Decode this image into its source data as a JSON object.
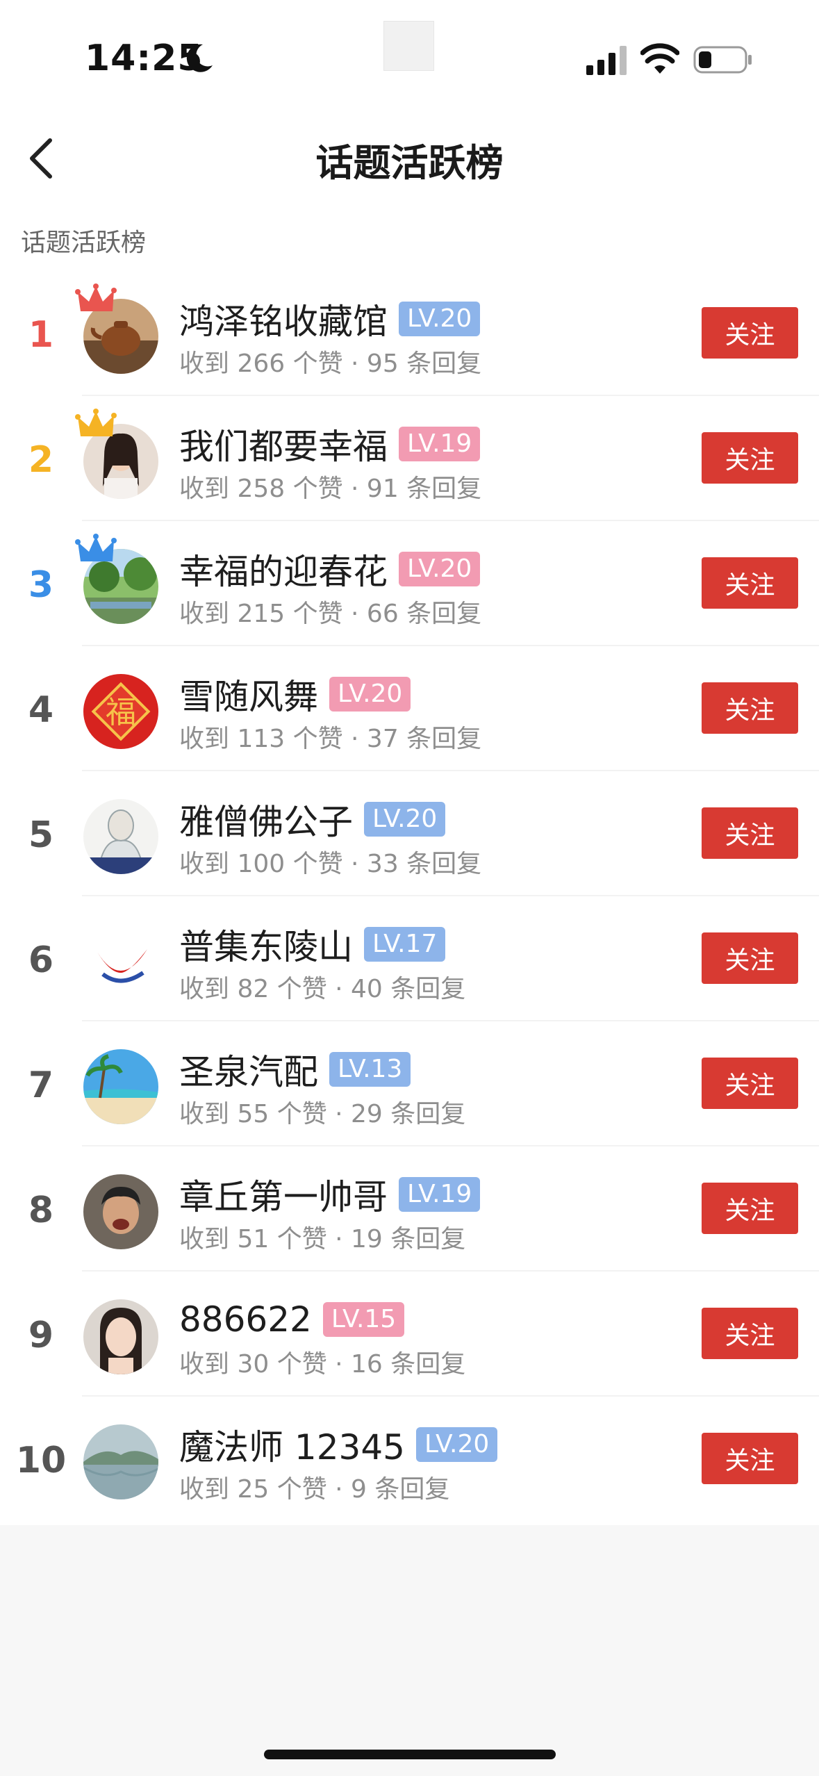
{
  "status_bar": {
    "time": "14:25"
  },
  "nav": {
    "title": "话题活跃榜"
  },
  "section_label": "话题活跃榜",
  "follow_label": "关注",
  "rank_colors": {
    "1": "#e9554f",
    "2": "#f5b324",
    "3": "#3a8ee6"
  },
  "items": [
    {
      "rank": "1",
      "name": "鸿泽铭收藏馆",
      "level": "LV.20",
      "level_color": "blue",
      "stats": "收到 266 个赞 · 95 条回复",
      "avatar": "teapot"
    },
    {
      "rank": "2",
      "name": "我们都要幸福",
      "level": "LV.19",
      "level_color": "pink",
      "stats": "收到 258 个赞 · 91 条回复",
      "avatar": "woman-portrait"
    },
    {
      "rank": "3",
      "name": "幸福的迎春花",
      "level": "LV.20",
      "level_color": "pink",
      "stats": "收到 215 个赞 · 66 条回复",
      "avatar": "park-landscape"
    },
    {
      "rank": "4",
      "name": "雪随风舞",
      "level": "LV.20",
      "level_color": "pink",
      "stats": "收到 113 个赞 · 37 条回复",
      "avatar": "fu-character"
    },
    {
      "rank": "5",
      "name": "雅僧佛公子",
      "level": "LV.20",
      "level_color": "blue",
      "stats": "收到 100 个赞 · 33 条回复",
      "avatar": "sketch-figure"
    },
    {
      "rank": "6",
      "name": "普集东陵山",
      "level": "LV.17",
      "level_color": "blue",
      "stats": "收到 82 个赞 · 40 条回复",
      "avatar": "red-logo"
    },
    {
      "rank": "7",
      "name": "圣泉汽配",
      "level": "LV.13",
      "level_color": "blue",
      "stats": "收到 55 个赞 · 29 条回复",
      "avatar": "beach"
    },
    {
      "rank": "8",
      "name": "章丘第一帅哥",
      "level": "LV.19",
      "level_color": "blue",
      "stats": "收到 51 个赞 · 19 条回复",
      "avatar": "man-laughing"
    },
    {
      "rank": "9",
      "name": "886622",
      "level": "LV.15",
      "level_color": "pink",
      "stats": "收到 30 个赞 · 16 条回复",
      "avatar": "woman-selfie"
    },
    {
      "rank": "10",
      "name": "魔法师 12345",
      "level": "LV.20",
      "level_color": "blue",
      "stats": "收到 25 个赞 · 9 条回复",
      "avatar": "lake-landscape"
    }
  ]
}
